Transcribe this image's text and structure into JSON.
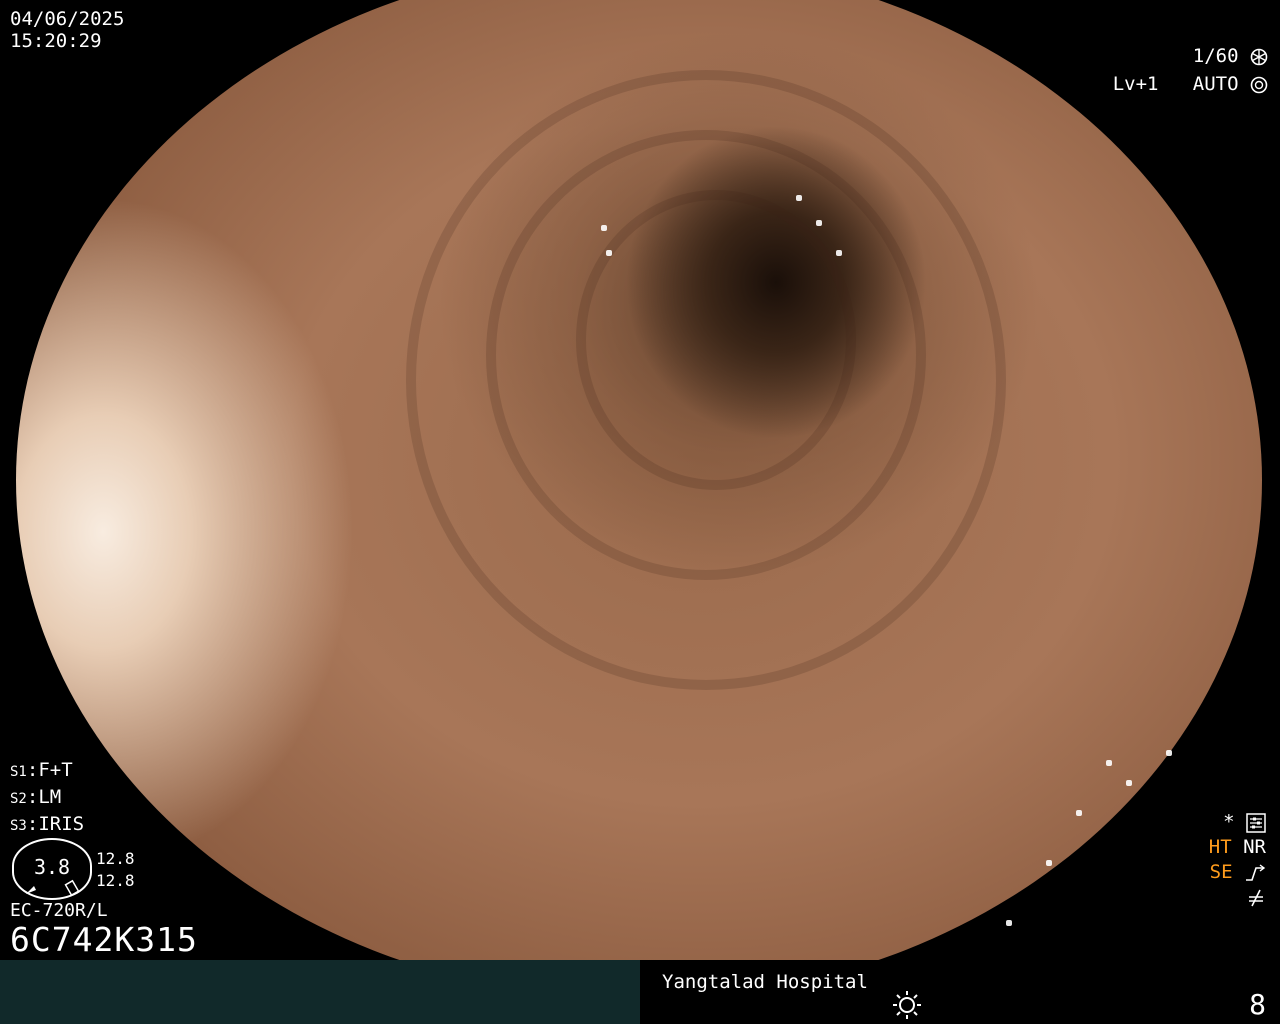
{
  "datetime": {
    "date": "04/06/2025",
    "time": "15:20:29"
  },
  "top_right": {
    "shutter": "1/60",
    "level": "Lv+1",
    "mode": "AUTO"
  },
  "settings": [
    {
      "key": "S1",
      "value": "F+T"
    },
    {
      "key": "S2",
      "value": "LM"
    },
    {
      "key": "S3",
      "value": "IRIS"
    }
  ],
  "gauge": {
    "value": "3.8",
    "upper": "12.8",
    "lower": "12.8"
  },
  "scope": {
    "model": "EC-720R/L",
    "serial": "6C742K315"
  },
  "indicators": {
    "star": "*",
    "ht": "HT",
    "nr": "NR",
    "se": "SE"
  },
  "footer": {
    "hospital": "Yangtalad Hospital",
    "page": "8"
  },
  "colors": {
    "accent_orange": "#ff9c1c",
    "footer_bar": "#11292a"
  }
}
